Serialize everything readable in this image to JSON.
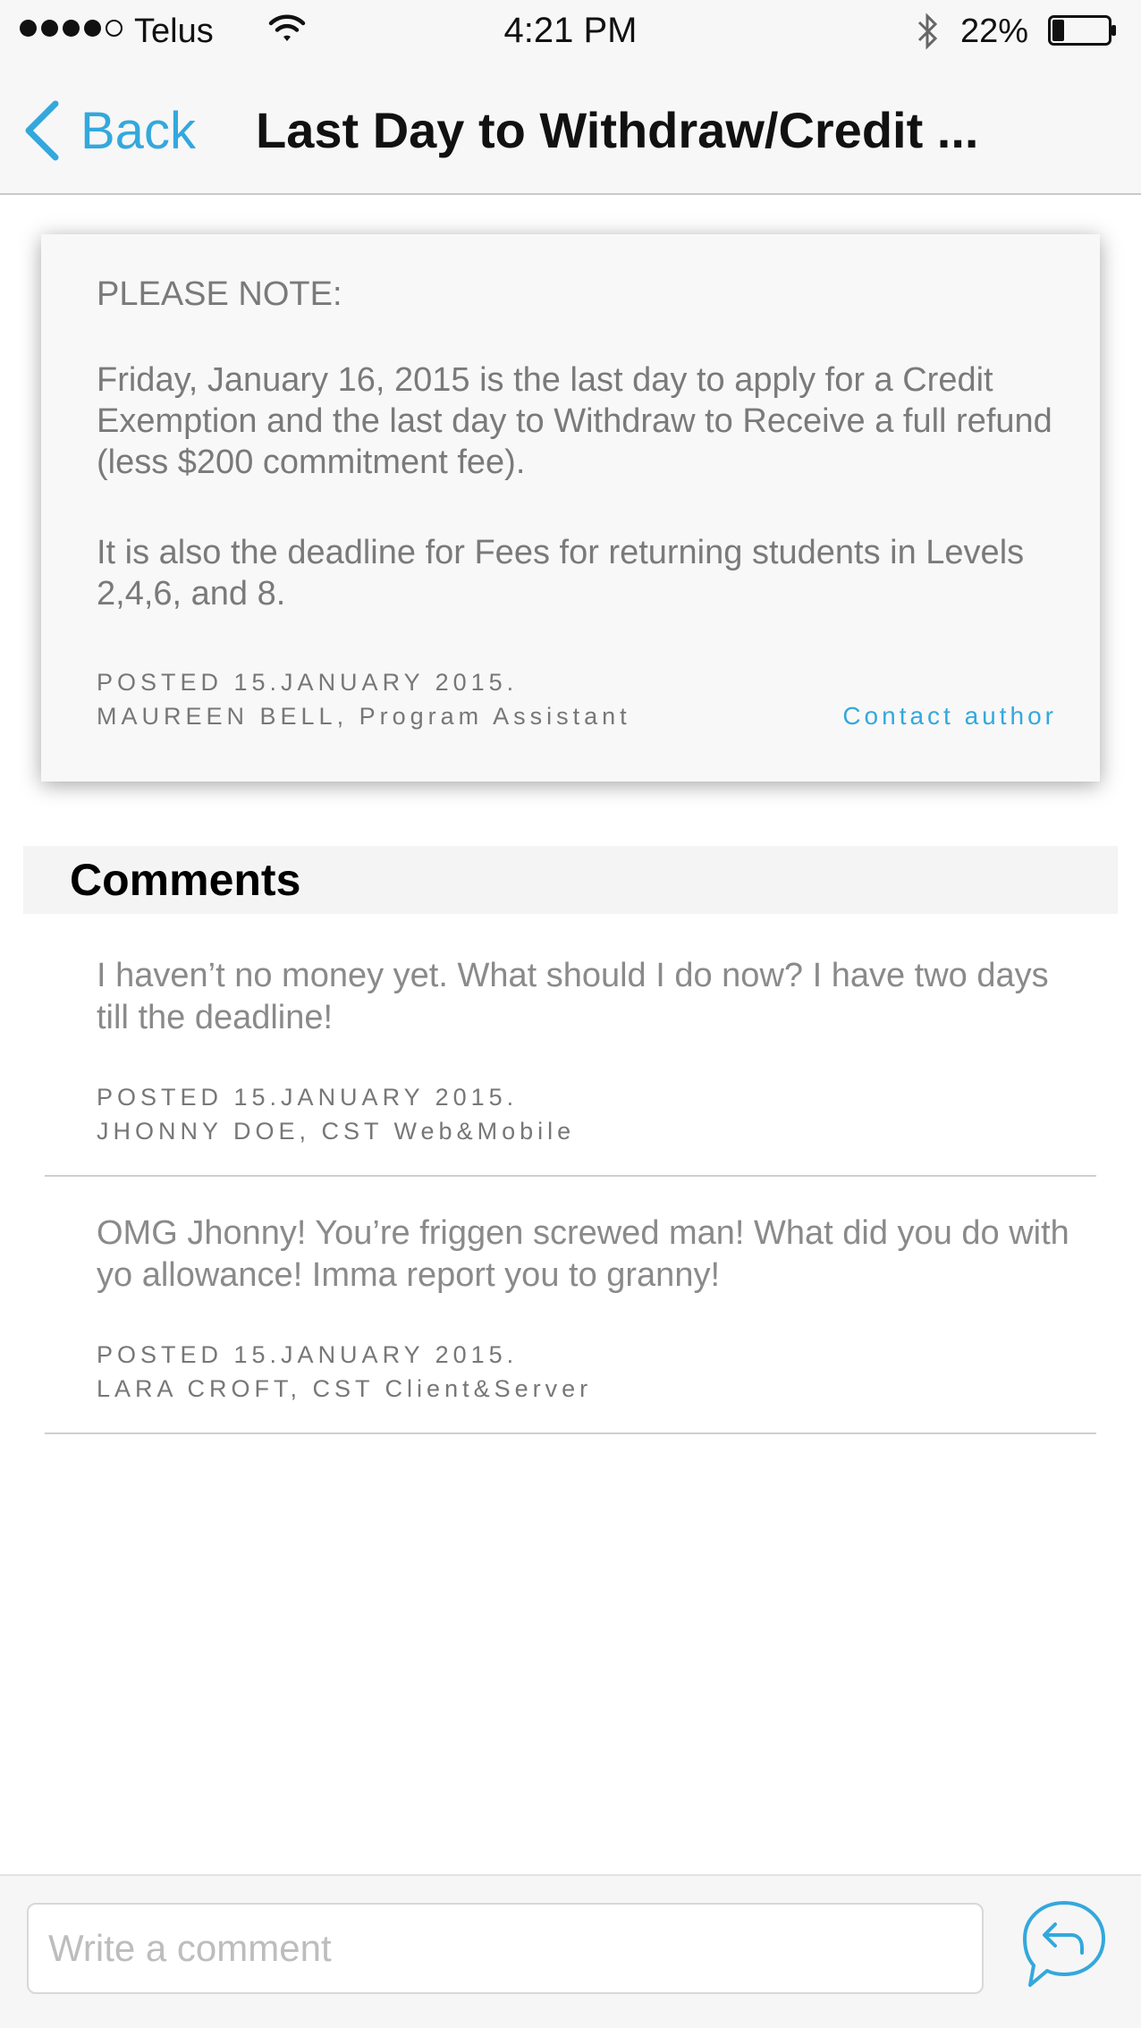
{
  "status_bar": {
    "signal": "●●●●○",
    "carrier": "Telus",
    "time": "4:21 PM",
    "battery_percent": "22%",
    "battery_level": 0.22,
    "icons": [
      "signal-dots-icon",
      "wifi-icon",
      "bluetooth-icon",
      "battery-icon"
    ]
  },
  "nav": {
    "back_label": "Back",
    "title": "Last Day to Withdraw/Credit ..."
  },
  "announcement": {
    "heading": "PLEASE NOTE:",
    "paragraphs": [
      "Friday, January 16, 2015 is the last day to apply for a Credit Exemption and the last day to Withdraw to Receive a full refund (less $200 commitment fee).",
      "It is also the deadline for Fees for returning students in Levels 2,4,6, and 8."
    ],
    "posted": "POSTED 15.JANUARY 2015.",
    "author": "MAUREEN BELL, Program Assistant",
    "contact_label": "Contact author"
  },
  "comments": {
    "title": "Comments",
    "items": [
      {
        "body": "I haven’t no money yet. What should I do now? I have two days till the deadline!",
        "posted": "POSTED 15.JANUARY 2015.",
        "byline": "JHONNY DOE, CST Web&Mobile"
      },
      {
        "body": "OMG Jhonny! You’re friggen screwed man! What did you do with yo allowance! Imma report you to granny!",
        "posted": "POSTED 15.JANUARY 2015.",
        "byline": "LARA CROFT, CST Client&Server"
      }
    ]
  },
  "composer": {
    "placeholder": "Write a comment",
    "value": "",
    "send_icon": "reply-bubble-icon"
  },
  "colors": {
    "accent": "#33a8dd",
    "body_text": "#7a7a7a",
    "bar_background": "#f7f7f7"
  }
}
